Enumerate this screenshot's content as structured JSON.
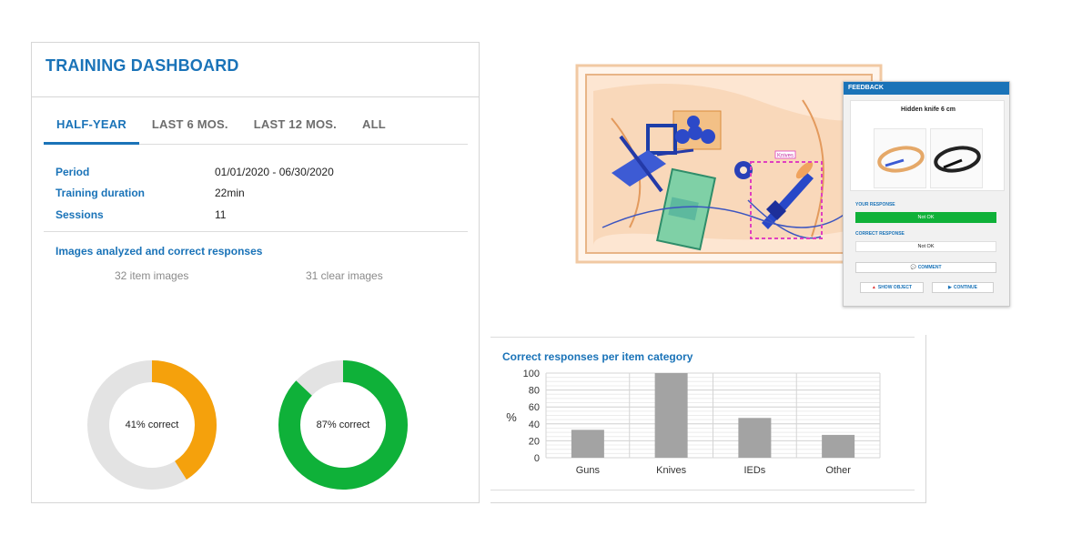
{
  "dashboard": {
    "title": "TRAINING DASHBOARD",
    "tabs": [
      {
        "label": "HALF-YEAR",
        "active": true
      },
      {
        "label": "LAST 6 MOS.",
        "active": false
      },
      {
        "label": "LAST 12 MOS.",
        "active": false
      },
      {
        "label": "ALL",
        "active": false
      }
    ],
    "info": [
      {
        "label": "Period",
        "value": "01/01/2020 - 06/30/2020"
      },
      {
        "label": "Training duration",
        "value": "22min"
      },
      {
        "label": "Sessions",
        "value": "11"
      }
    ],
    "section_title": "Images analyzed and correct responses",
    "item_images": "32 item images",
    "clear_images": "31 clear images",
    "donuts": [
      {
        "label": "41% correct",
        "percent": 41,
        "color": "#f5a10c"
      },
      {
        "label": "87% correct",
        "percent": 87,
        "color": "#0fb139"
      }
    ],
    "donut_track_color": "#e3e3e3"
  },
  "xray": {
    "detection_label": "Knives"
  },
  "feedback": {
    "title": "FEEDBACK",
    "object_title": "Hidden knife 6 cm",
    "your_response_label": "YOUR RESPONSE",
    "your_response": "Not OK",
    "your_response_color": "#0fb139",
    "correct_response_label": "CORRECT RESPONSE",
    "correct_response": "Not OK",
    "comment_button": "COMMENT",
    "show_object_button": "SHOW OBJECT",
    "continue_button": "CONTINUE"
  },
  "chart_data": {
    "type": "bar",
    "title": "Correct responses per item category",
    "ylabel": "%",
    "xlabel": "",
    "categories": [
      "Guns",
      "Knives",
      "IEDs",
      "Other"
    ],
    "values": [
      33,
      100,
      47,
      27
    ],
    "ylim": [
      0,
      100
    ],
    "yticks": [
      0,
      20,
      40,
      60,
      80,
      100
    ],
    "grid": true,
    "bar_color": "#a3a3a3"
  }
}
